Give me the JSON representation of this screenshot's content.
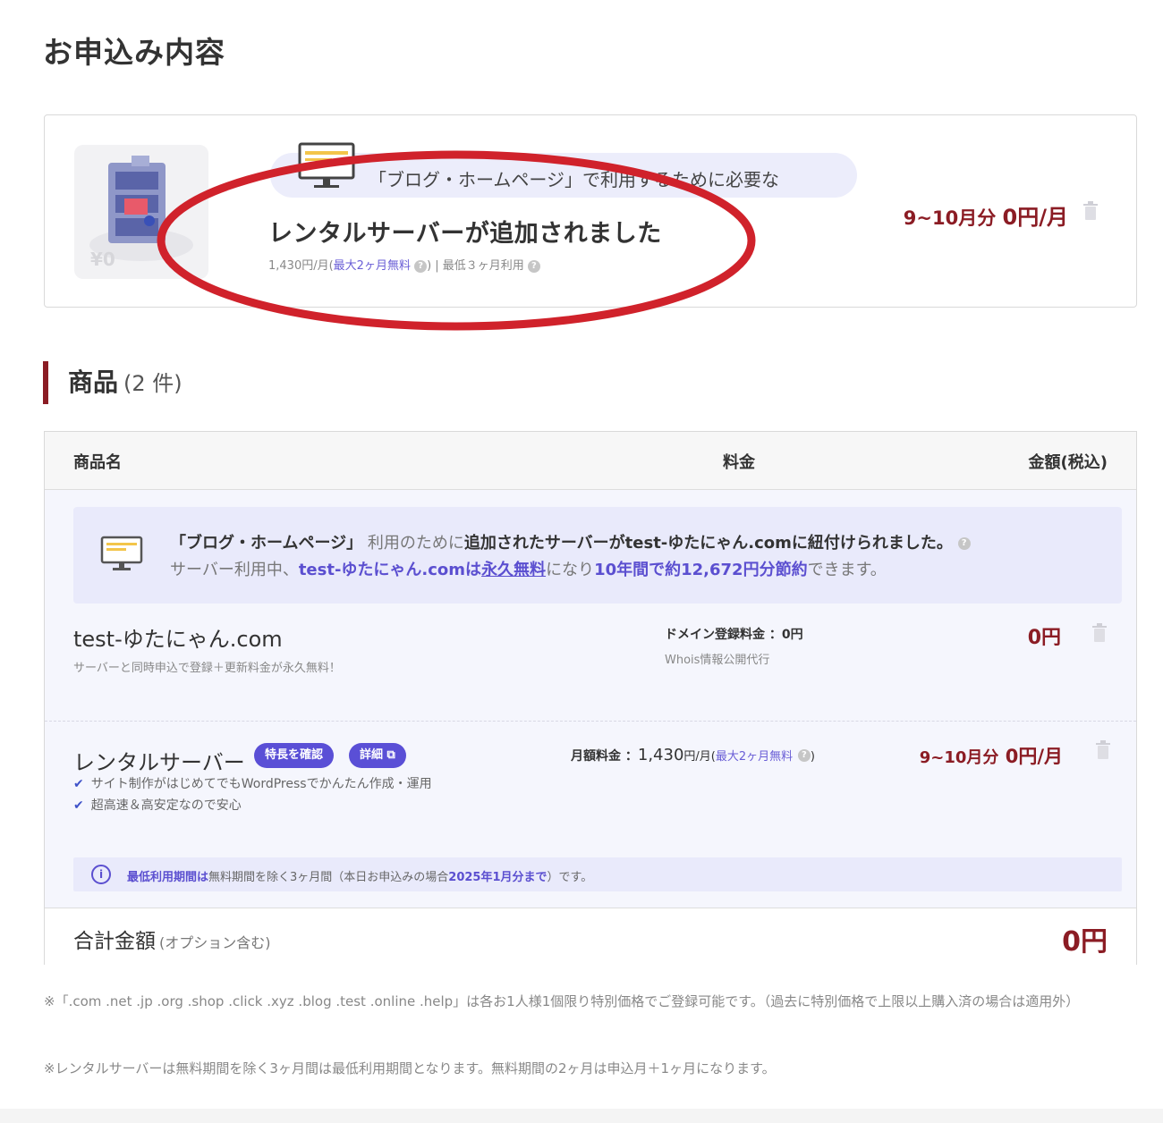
{
  "page": {
    "title": "お申込み内容"
  },
  "added_card": {
    "pill_text": "「ブログ・ホームページ」で利用するために必要な",
    "title": "レンタルサーバーが追加されました",
    "sub_price": "1,430円/月(",
    "sub_free": "最大2ヶ月無料",
    "sub_sep": ") | 最低３ヶ月利用",
    "price_period": "9~10月分",
    "price_value": "0円/月",
    "annotation_color": "#d0222b"
  },
  "products": {
    "heading": "商品",
    "count": "(2 件)",
    "columns": {
      "name": "商品名",
      "fee": "料金",
      "amount": "金額(税込)"
    },
    "notice": {
      "l1_a": "「ブログ・ホームページ」",
      "l1_b": "利用のために",
      "l1_c": "追加されたサーバーがtest-ゆたにゃん.comに紐付けられました。",
      "l2_a": "サーバー利用中、",
      "l2_b": "test-ゆたにゃん.comは",
      "l2_c": "永久無料",
      "l2_d": "になり",
      "l2_e": "10年間で約12,672円分節約",
      "l2_f": "できます。"
    },
    "domain_row": {
      "name": "test-ゆたにゃん.com",
      "desc": "サーバーと同時申込で登録＋更新料金が永久無料！",
      "fee": "ドメイン登録料金 ：0円",
      "fee_sub": "Whois情報公開代行",
      "amount": "0円"
    },
    "server_row": {
      "name": "レンタルサーバー",
      "tag_features": "特長を確認",
      "tag_detail": "詳細",
      "check1": "サイト制作がはじめてでもWordPressでかんたん作成・運用",
      "check2": "超高速＆高安定なので安心",
      "fee_label": "月額料金 ：",
      "fee_value": "1,430",
      "fee_unit": "円/月(",
      "fee_free": "最大2ヶ月無料",
      "fee_close": ")",
      "amount_period": "9~10月分",
      "amount_value": "0円/月",
      "info_a": "最低利用期間は",
      "info_b": "無料期間を除く3ヶ月間（本日お申込みの場合",
      "info_c": "2025年1月分まで",
      "info_d": "）です。"
    },
    "total": {
      "label": "合計金額",
      "option": "(オプション含む)",
      "value": "0円"
    }
  },
  "footnotes": {
    "note1": "※「.com .net .jp .org .shop .click .xyz .blog .test .online .help」は各お1人様1個限り特別価格でご登録可能です。（過去に特別価格で上限以上購入済の場合は適用外）",
    "note2": "※レンタルサーバーは無料期間を除く3ヶ月間は最低利用期間となります。無料期間の2ヶ月は申込月＋1ヶ月になります。"
  }
}
